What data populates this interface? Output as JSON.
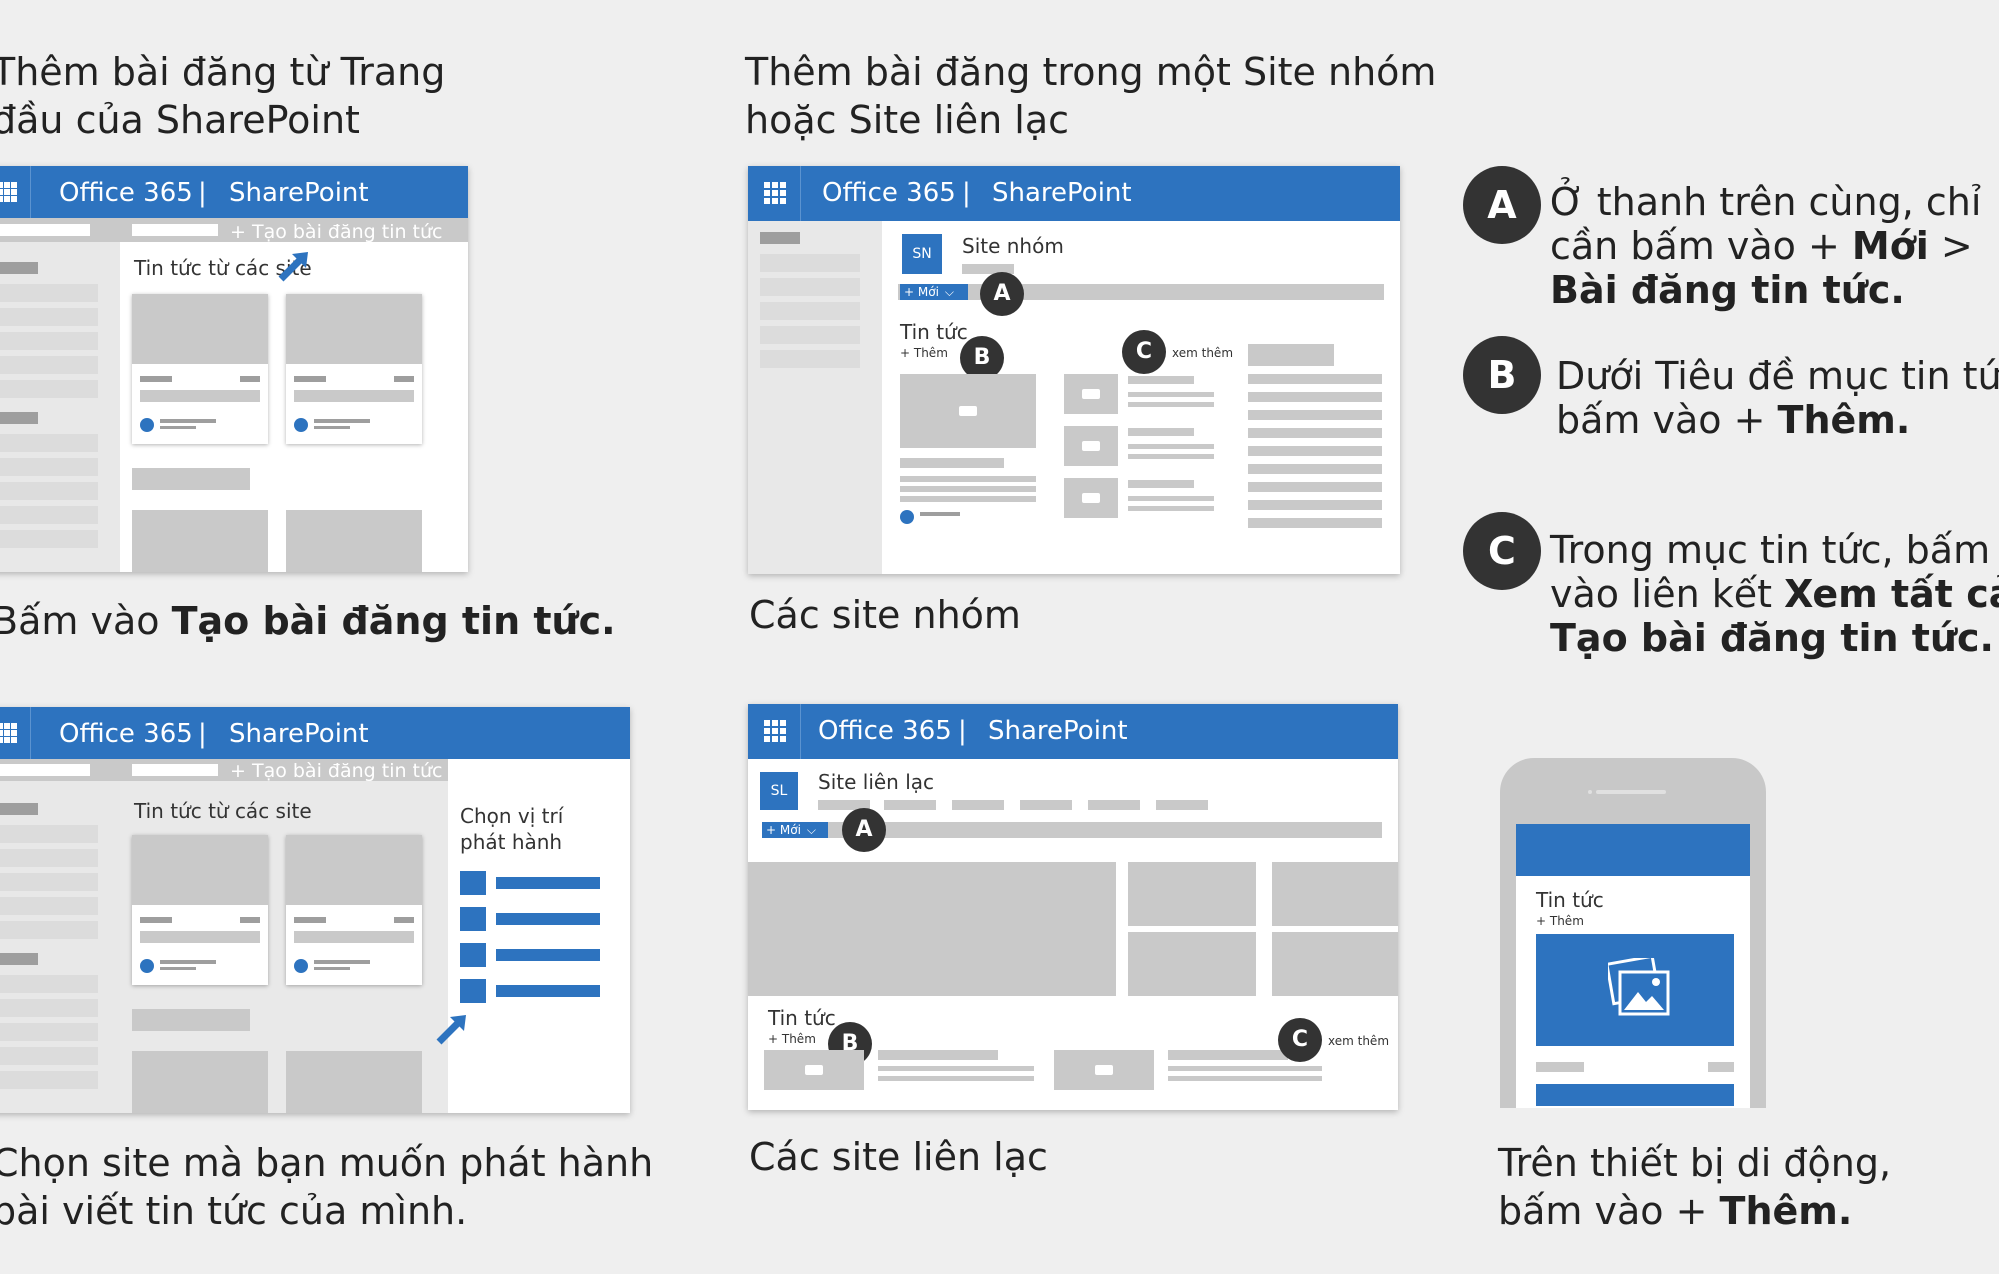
{
  "headings": {
    "home": [
      "Thêm bài đăng từ Trang",
      "đầu của SharePoint"
    ],
    "site": [
      "Thêm bài đăng trong một Site nhóm",
      "hoặc Site liên lạc"
    ]
  },
  "captions": {
    "home_top_prefix": "Bấm vào ",
    "home_top_bold": "Tạo bài đăng tin tức.",
    "home_bottom": [
      "Chọn site mà bạn muốn phát hành",
      "bài viết tin tức của mình."
    ],
    "team": "Các site nhóm",
    "comm": "Các site liên lạc",
    "mobile_line1": "Trên thiết bị di động,",
    "mobile_line2_prefix": "bấm vào + ",
    "mobile_line2_bold": "Thêm."
  },
  "suitebar": {
    "office": "Office 365",
    "sep": "|",
    "app": "SharePoint"
  },
  "home_mock": {
    "create_post": "+ Tạo bài đăng tin tức",
    "news_from_sites": "Tin tức từ các site",
    "choose_location": [
      "Chọn vị trí",
      "phát hành"
    ]
  },
  "team_mock": {
    "initials": "SN",
    "site_name": "Site nhóm",
    "new_button": "+ Mới",
    "news_title": "Tin tức",
    "add": "+ Thêm",
    "see_all": "xem thêm"
  },
  "comm_mock": {
    "initials": "SL",
    "site_name": "Site liên lạc",
    "new_button": "+ Mới",
    "news_title": "Tin tức",
    "add": "+ Thêm",
    "see_all": "xem thêm"
  },
  "mobile_mock": {
    "news_title": "Tin tức",
    "add": "+ Thêm"
  },
  "markers": {
    "a": "A",
    "b": "B",
    "c": "C"
  },
  "steps": {
    "a": {
      "line1": "Ở thanh trên cùng, chỉ",
      "line2_prefix": "cần bấm vào + ",
      "line2_bold": "Mới",
      "line2_suffix": " >",
      "line3_bold": "Bài đăng tin tức."
    },
    "b": {
      "line1": "Dưới Tiêu đề mục tin tức,",
      "line2_prefix": "bấm vào + ",
      "line2_bold": "Thêm."
    },
    "c": {
      "line1": "Trong mục tin tức, bấm",
      "line2_prefix": "vào liên kết ",
      "line2_bold": "Xem tất cả",
      "line2_suffix": " >",
      "line3_bold": "Tạo bài đăng tin tức."
    }
  },
  "colors": {
    "brand": "#2d73bf",
    "marker": "#333333",
    "background": "#efefef"
  }
}
